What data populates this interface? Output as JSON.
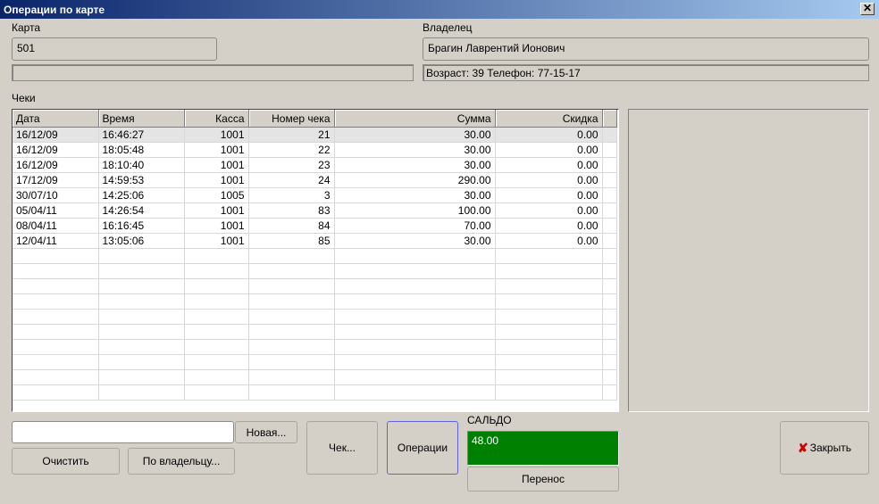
{
  "window": {
    "title": "Операции по карте",
    "close_glyph": "✕"
  },
  "card": {
    "label": "Карта",
    "number": "501",
    "extra": ""
  },
  "owner": {
    "label": "Владелец",
    "name": "Брагин Лаврентий Ионович",
    "info": "Возраст: 39  Телефон: 77-15-17"
  },
  "receipts": {
    "label": "Чеки",
    "columns": [
      "Дата",
      "Время",
      "Касса",
      "Номер чека",
      "Сумма",
      "Скидка"
    ],
    "rows": [
      [
        "16/12/09",
        "16:46:27",
        "1001",
        "21",
        "30.00",
        "0.00"
      ],
      [
        "16/12/09",
        "18:05:48",
        "1001",
        "22",
        "30.00",
        "0.00"
      ],
      [
        "16/12/09",
        "18:10:40",
        "1001",
        "23",
        "30.00",
        "0.00"
      ],
      [
        "17/12/09",
        "14:59:53",
        "1001",
        "24",
        "290.00",
        "0.00"
      ],
      [
        "30/07/10",
        "14:25:06",
        "1005",
        "3",
        "30.00",
        "0.00"
      ],
      [
        "05/04/11",
        "14:26:54",
        "1001",
        "83",
        "100.00",
        "0.00"
      ],
      [
        "08/04/11",
        "16:16:45",
        "1001",
        "84",
        "70.00",
        "0.00"
      ],
      [
        "12/04/11",
        "13:05:06",
        "1001",
        "85",
        "30.00",
        "0.00"
      ]
    ],
    "selected_row": 0
  },
  "search": {
    "value": "",
    "new_label": "Новая..."
  },
  "buttons": {
    "clear": "Очистить",
    "by_owner": "По владельцу...",
    "receipt": "Чек...",
    "operations": "Операции",
    "transfer": "Перенос",
    "close": "Закрыть"
  },
  "saldo": {
    "label": "САЛЬДО",
    "value": "48.00",
    "color": "#008000"
  },
  "icons": {
    "close_button": "red-x-icon"
  }
}
